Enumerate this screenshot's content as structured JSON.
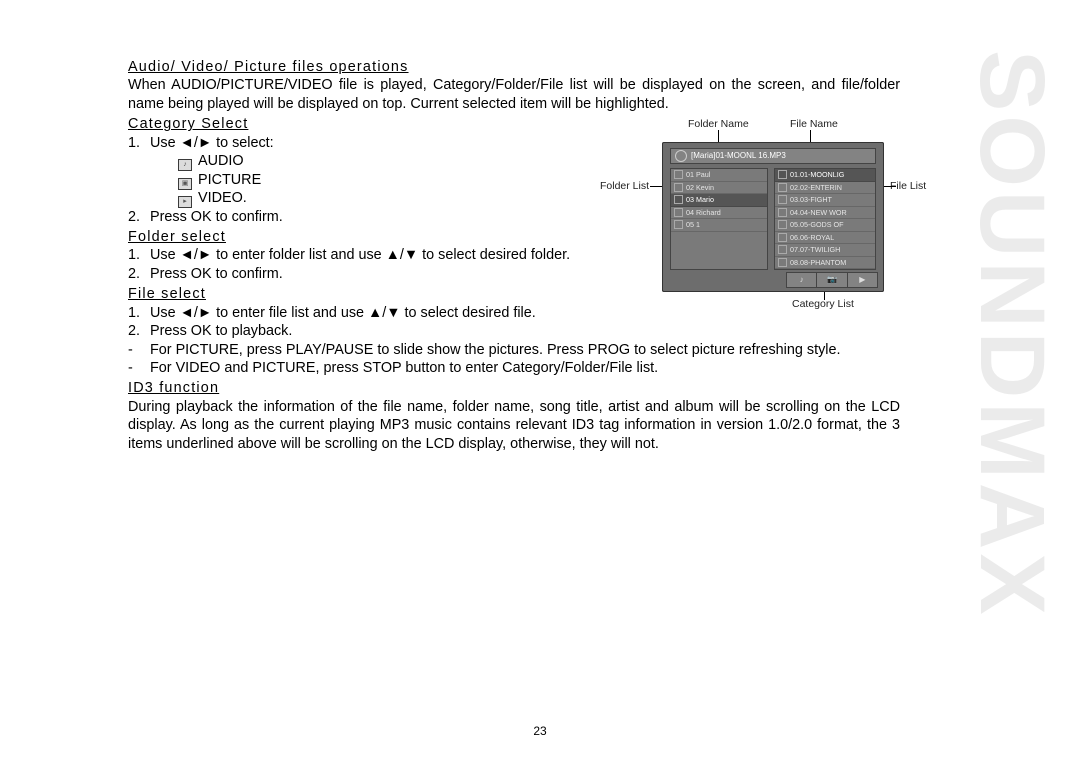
{
  "brand": "SOUNDMAX",
  "page_number": "23",
  "headings": {
    "h1": "Audio/ Video/ Picture files operations",
    "h2": "Category Select",
    "h3": "Folder select",
    "h4": "File select",
    "h5": "ID3 function"
  },
  "text": {
    "intro": "When AUDIO/PICTURE/VIDEO file is played, Category/Folder/File list will be displayed on the screen, and file/folder name being played will be displayed on top. Current selected item will be highlighted.",
    "cat_1a": "Use  ◄/►  to select:",
    "cat_audio": "AUDIO",
    "cat_picture": "PICTURE",
    "cat_video": "VIDEO.",
    "cat_2": "Press OK to confirm.",
    "fold_1": "Use   ◄/►   to   enter   folder   list   and   use        ▲/▼   to   select desired folder.",
    "fold_2": "Press OK to confirm.",
    "file_1": "Use   ◄/►   to enter file list and use          ▲/▼   to select desired file.",
    "file_2": "Press OK to playback.",
    "file_note1": "For  PICTURE,  press  PLAY/PAUSE  to  slide  show  the  pictures.  Press  PROG  to  select  picture  refreshing style.",
    "file_note2": "For VIDEO and PICTURE, press STOP button to enter Category/Folder/File list.",
    "id3": "During playback the information of the file name, folder name, song title, artist and album will be scrolling on  the  LCD  display.  As  long  as  the  current  playing  MP3  music  contains  relevant  ID3  tag  information  in version 1.0/2.0 format, the 3 items underlined above will be scrolling on the LCD display, otherwise, they will not."
  },
  "figure": {
    "labels": {
      "folder_name": "Folder Name",
      "file_name": "File Name",
      "folder_list": "Folder List",
      "file_list": "File List",
      "category_list": "Category List"
    },
    "title_bar": "[Maria]01-MOONL 16.MP3",
    "folders": [
      "01 Paul",
      "02 Kevin",
      "03 Mario",
      "04 Richard",
      "05 1"
    ],
    "selected_folder_index": 2,
    "files": [
      "01.01-MOONLIG",
      "02.02-ENTERIN",
      "03.03-FIGHT",
      "04.04-NEW WOR",
      "05.05-GODS OF",
      "06.06-ROYAL",
      "07.07-TWILIGH",
      "08.08-PHANTOM"
    ],
    "selected_file_index": 0,
    "categories": [
      "♪",
      "📷",
      "▶"
    ]
  }
}
